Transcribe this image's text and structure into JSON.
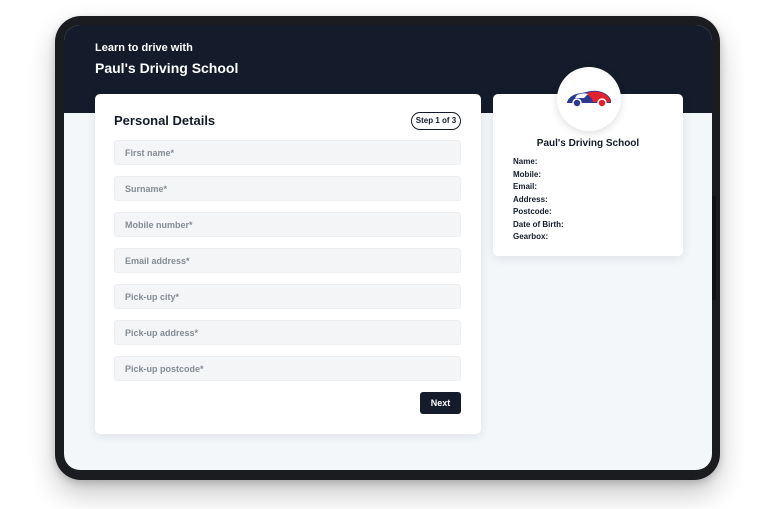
{
  "hero": {
    "subtitle": "Learn to drive with",
    "title": "Paul's Driving School"
  },
  "form": {
    "title": "Personal Details",
    "step": "Step 1 of 3",
    "fields": {
      "first_name": {
        "placeholder": "First name*",
        "value": ""
      },
      "surname": {
        "placeholder": "Surname*",
        "value": ""
      },
      "mobile": {
        "placeholder": "Mobile number*",
        "value": ""
      },
      "email": {
        "placeholder": "Email address*",
        "value": ""
      },
      "city": {
        "placeholder": "Pick-up city*",
        "value": ""
      },
      "address": {
        "placeholder": "Pick-up address*",
        "value": ""
      },
      "postcode": {
        "placeholder": "Pick-up postcode*",
        "value": ""
      }
    },
    "next_label": "Next"
  },
  "summary": {
    "logo_icon": "car-logo-icon",
    "title": "Paul's Driving School",
    "labels": {
      "name": "Name:",
      "mobile": "Mobile:",
      "email": "Email:",
      "address": "Address:",
      "postcode": "Postcode:",
      "dob": "Date of Birth:",
      "gearbox": "Gearbox:"
    }
  },
  "colors": {
    "brand_dark": "#141c2b",
    "logo_blue": "#2b3a8f",
    "logo_red": "#e0232e",
    "page_bg": "#f4f7fa"
  }
}
